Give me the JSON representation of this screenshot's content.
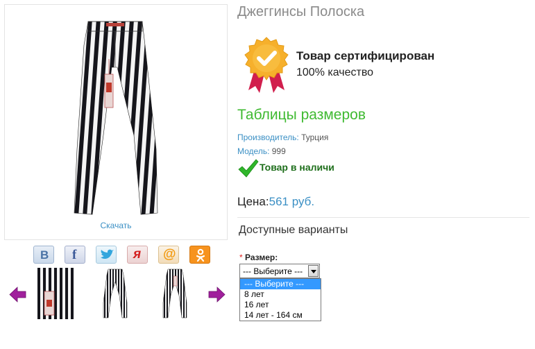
{
  "product": {
    "title": "Джеггинсы Полоска",
    "download_label": "Скачать",
    "certificate": {
      "title": "Товар сертифицирован",
      "subtitle": "100% качество"
    },
    "size_table_label": "Таблицы размеров",
    "manufacturer": {
      "label": "Производитель:",
      "value": "Турция"
    },
    "model": {
      "label": "Модель:",
      "value": "999"
    },
    "stock_text": "Товар в наличи",
    "price": {
      "label": "Цена:",
      "value": "561 руб."
    },
    "variants_heading": "Доступные варианты",
    "size": {
      "required_mark": "*",
      "label": "Размер:",
      "selected": "--- Выберите ---",
      "options": [
        "--- Выберите ---",
        "8 лет",
        "16 лет",
        "14 лет - 164 см"
      ]
    }
  },
  "social": {
    "vk": "В",
    "facebook": "f",
    "twitter": "twitter-bird-icon",
    "yaru": "я",
    "mailru": "@",
    "ok": "ok-icon"
  },
  "colors": {
    "link": "#3a8fc4",
    "green_heading": "#3fba31",
    "stock": "#1f6f1c",
    "arrow": "#a0209c",
    "select_highlight": "#3399ff"
  }
}
